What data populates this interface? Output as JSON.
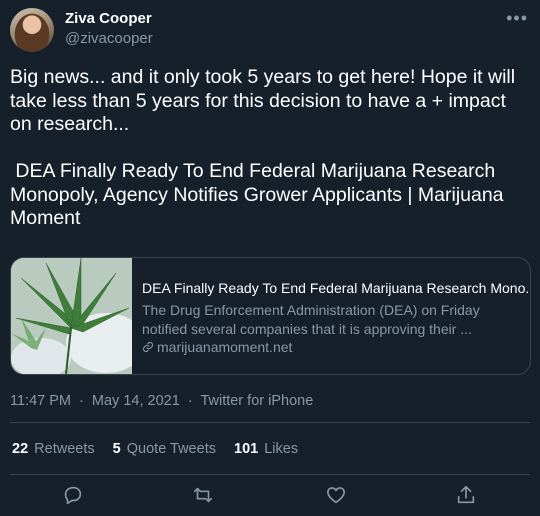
{
  "tweet": {
    "author_name": "Ziva Cooper",
    "author_handle": "@zivacooper",
    "more_glyph": "•••",
    "text": "Big news... and it only took 5 years to get here! Hope it will take less than 5 years for this decision to have a + impact on research...\n\n DEA Finally Ready To End Federal Marijuana Research Monopoly, Agency Notifies Grower Applicants | Marijuana Moment",
    "card": {
      "title": "DEA Finally Ready To End Federal Marijuana Research Mono...",
      "description": "The Drug Enforcement Administration (DEA) on Friday notified several companies that it is approving their ...",
      "domain": "marijuanamoment.net"
    },
    "time": "11:47 PM",
    "date": "May 14, 2021",
    "separator": "·",
    "source": "Twitter for iPhone",
    "stats": {
      "retweets_count": "22",
      "retweets_label": "Retweets",
      "quotes_count": "5",
      "quotes_label": "Quote Tweets",
      "likes_count": "101",
      "likes_label": "Likes"
    }
  },
  "colors": {
    "background": "#15202b",
    "secondary_text": "#8899a6",
    "border": "#38444d"
  },
  "icons": [
    "more-icon",
    "link-icon",
    "reply-icon",
    "retweet-icon",
    "like-icon",
    "share-icon"
  ]
}
